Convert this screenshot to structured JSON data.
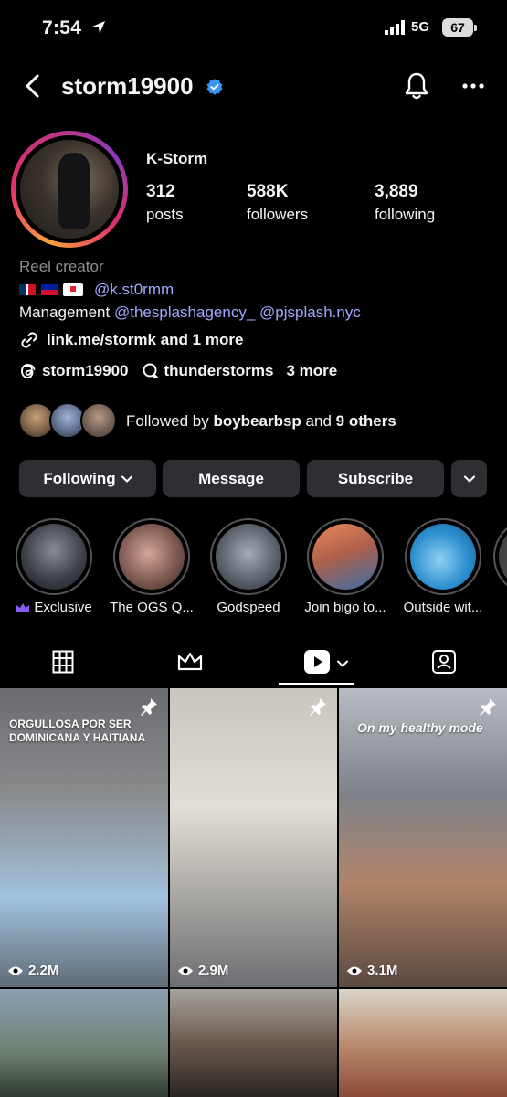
{
  "status_bar": {
    "time": "7:54",
    "network": "5G",
    "battery": "67"
  },
  "header": {
    "username": "storm19900"
  },
  "profile": {
    "display_name": "K-Storm",
    "stats": [
      {
        "value": "312",
        "label": "posts"
      },
      {
        "value": "588K",
        "label": "followers"
      },
      {
        "value": "3,889",
        "label": "following"
      }
    ],
    "category": "Reel creator",
    "bio_handle": "@k.st0rmm",
    "management_label": "Management",
    "management_handles": [
      "@thesplashagency_",
      "@pjsplash.nyc"
    ],
    "link_text": "link.me/stormk and 1 more",
    "threads_handle": "storm19900",
    "thread_chat": "thunderstorms",
    "more_links": "3 more",
    "followed_by_prefix": "Followed by",
    "followed_by_name": "boybearbsp",
    "followed_by_and": "and",
    "followed_by_others": "9 others"
  },
  "actions": {
    "following": "Following",
    "message": "Message",
    "subscribe": "Subscribe"
  },
  "highlights": [
    {
      "label": "Exclusive",
      "color": "#3b3d46"
    },
    {
      "label": "The OGS Q...",
      "color": "#7d5a52"
    },
    {
      "label": "Godspeed",
      "color": "#5d6470"
    },
    {
      "label": "Join bigo to...",
      "color": "#b0604a"
    },
    {
      "label": "Outside wit...",
      "color": "#2d8fcf"
    }
  ],
  "grid": [
    {
      "caption": "ORGULLOSA POR SER DOMINICANA Y HAITIANA",
      "views": "2.2M",
      "pinned": true
    },
    {
      "caption": "",
      "views": "2.9M",
      "pinned": true
    },
    {
      "caption": "On my healthy mode",
      "views": "3.1M",
      "pinned": true
    },
    {
      "caption": "",
      "views": "",
      "pinned": false
    },
    {
      "caption": "",
      "views": "",
      "pinned": false
    },
    {
      "caption": "",
      "views": "",
      "pinned": false
    }
  ],
  "colors": {
    "accent_link": "#a3a8ff",
    "verified": "#3897f0",
    "button_bg": "#2e2f33",
    "exclusive_crown": "#8a5cf6"
  }
}
